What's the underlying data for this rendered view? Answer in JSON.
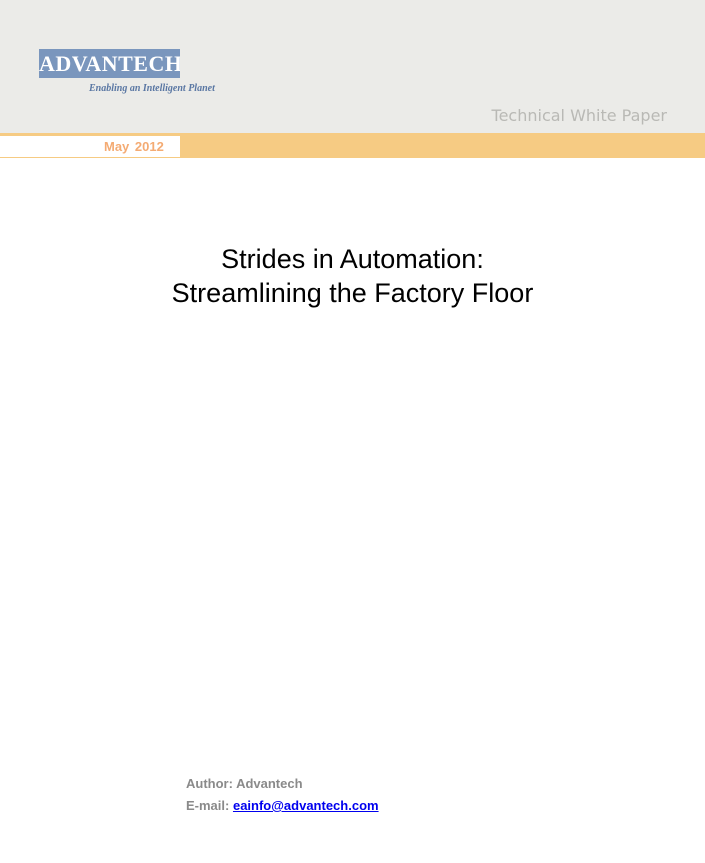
{
  "header": {
    "logo_text": "ADVANTECH",
    "tagline": "Enabling an Intelligent Planet",
    "doc_type": "Technical White Paper",
    "date": "May 2012"
  },
  "title": {
    "line1": "Strides in Automation:",
    "line2": "Streamlining the Factory Floor"
  },
  "meta": {
    "author_label": "Author:",
    "author": "Advantech",
    "email_label": "E-mail:",
    "email": "eainfo@advantech.com"
  },
  "colors": {
    "header_band": "#ebebe8",
    "logo_box": "#7a96bd",
    "date_strip": "#f6cb83",
    "date_text": "#f4ab73"
  }
}
